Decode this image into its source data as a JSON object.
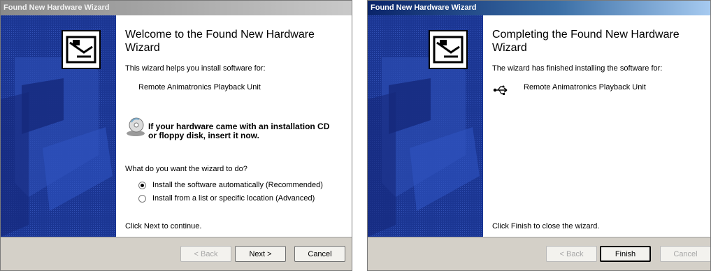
{
  "left_window": {
    "title": "Found New Hardware Wizard",
    "heading": "Welcome to the Found New Hardware Wizard",
    "intro": "This wizard helps you install software for:",
    "device": "Remote Animatronics Playback Unit",
    "cd_prompt_line1": "If your hardware came with an installation CD",
    "cd_prompt_line2": "or floppy disk, insert it now.",
    "question": "What do you want the wizard to do?",
    "option_auto": "Install the software automatically (Recommended)",
    "option_manual": "Install from a list or specific location (Advanced)",
    "selected_option": "option_auto",
    "continue_text": "Click Next to continue.",
    "back_label": "< Back",
    "next_label": "Next >",
    "cancel_label": "Cancel"
  },
  "right_window": {
    "title": "Found New Hardware Wizard",
    "heading": "Completing the Found New Hardware Wizard",
    "finished_text": "The wizard has finished installing the software for:",
    "device": "Remote Animatronics Playback Unit",
    "close_text": "Click Finish to close the wizard.",
    "back_label": "< Back",
    "finish_label": "Finish",
    "cancel_label": "Cancel"
  },
  "colors": {
    "sidebar_blue": "#1f3c9a",
    "active_title_start": "#0a246a",
    "inactive_title_start": "#8a8a8a"
  }
}
